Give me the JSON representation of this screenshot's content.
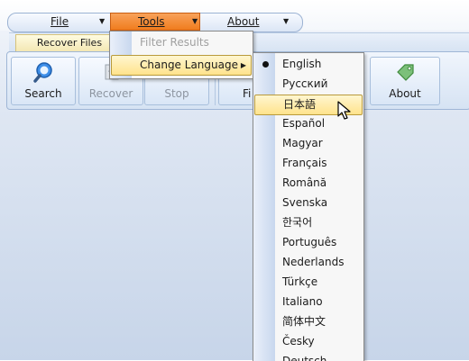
{
  "menubar": {
    "items": [
      {
        "label": "File"
      },
      {
        "label": "Tools"
      },
      {
        "label": "About"
      }
    ]
  },
  "ribbon": {
    "tab_label": "Recover Files",
    "buttons": [
      {
        "label": "Search",
        "icon": "magnifier-icon",
        "enabled": true
      },
      {
        "label": "Recover",
        "icon": "recover-icon",
        "enabled": false
      },
      {
        "label": "Stop",
        "icon": "stop-icon",
        "enabled": false
      },
      {
        "label": "Fi",
        "icon": "filter-icon",
        "enabled": true
      },
      {
        "label": "About",
        "icon": "tag-icon",
        "enabled": true
      }
    ]
  },
  "tools_menu": {
    "items": [
      {
        "label": "Filter Results",
        "enabled": false
      },
      {
        "label": "Change Language",
        "enabled": true,
        "has_submenu": true
      }
    ]
  },
  "language_menu": {
    "selected": "English",
    "highlighted": "日本語",
    "items": [
      "English",
      "Русский",
      "日本語",
      "Español",
      "Magyar",
      "Français",
      "Română",
      "Svenska",
      "한국어",
      "Português",
      "Nederlands",
      "Türkçe",
      "Italiano",
      "简体中文",
      "Česky",
      "Deutsch"
    ]
  },
  "colors": {
    "accent_orange": "#f07c1e",
    "highlight_yellow": "#ffe38c",
    "ribbon_blue": "#d6e3f3"
  }
}
